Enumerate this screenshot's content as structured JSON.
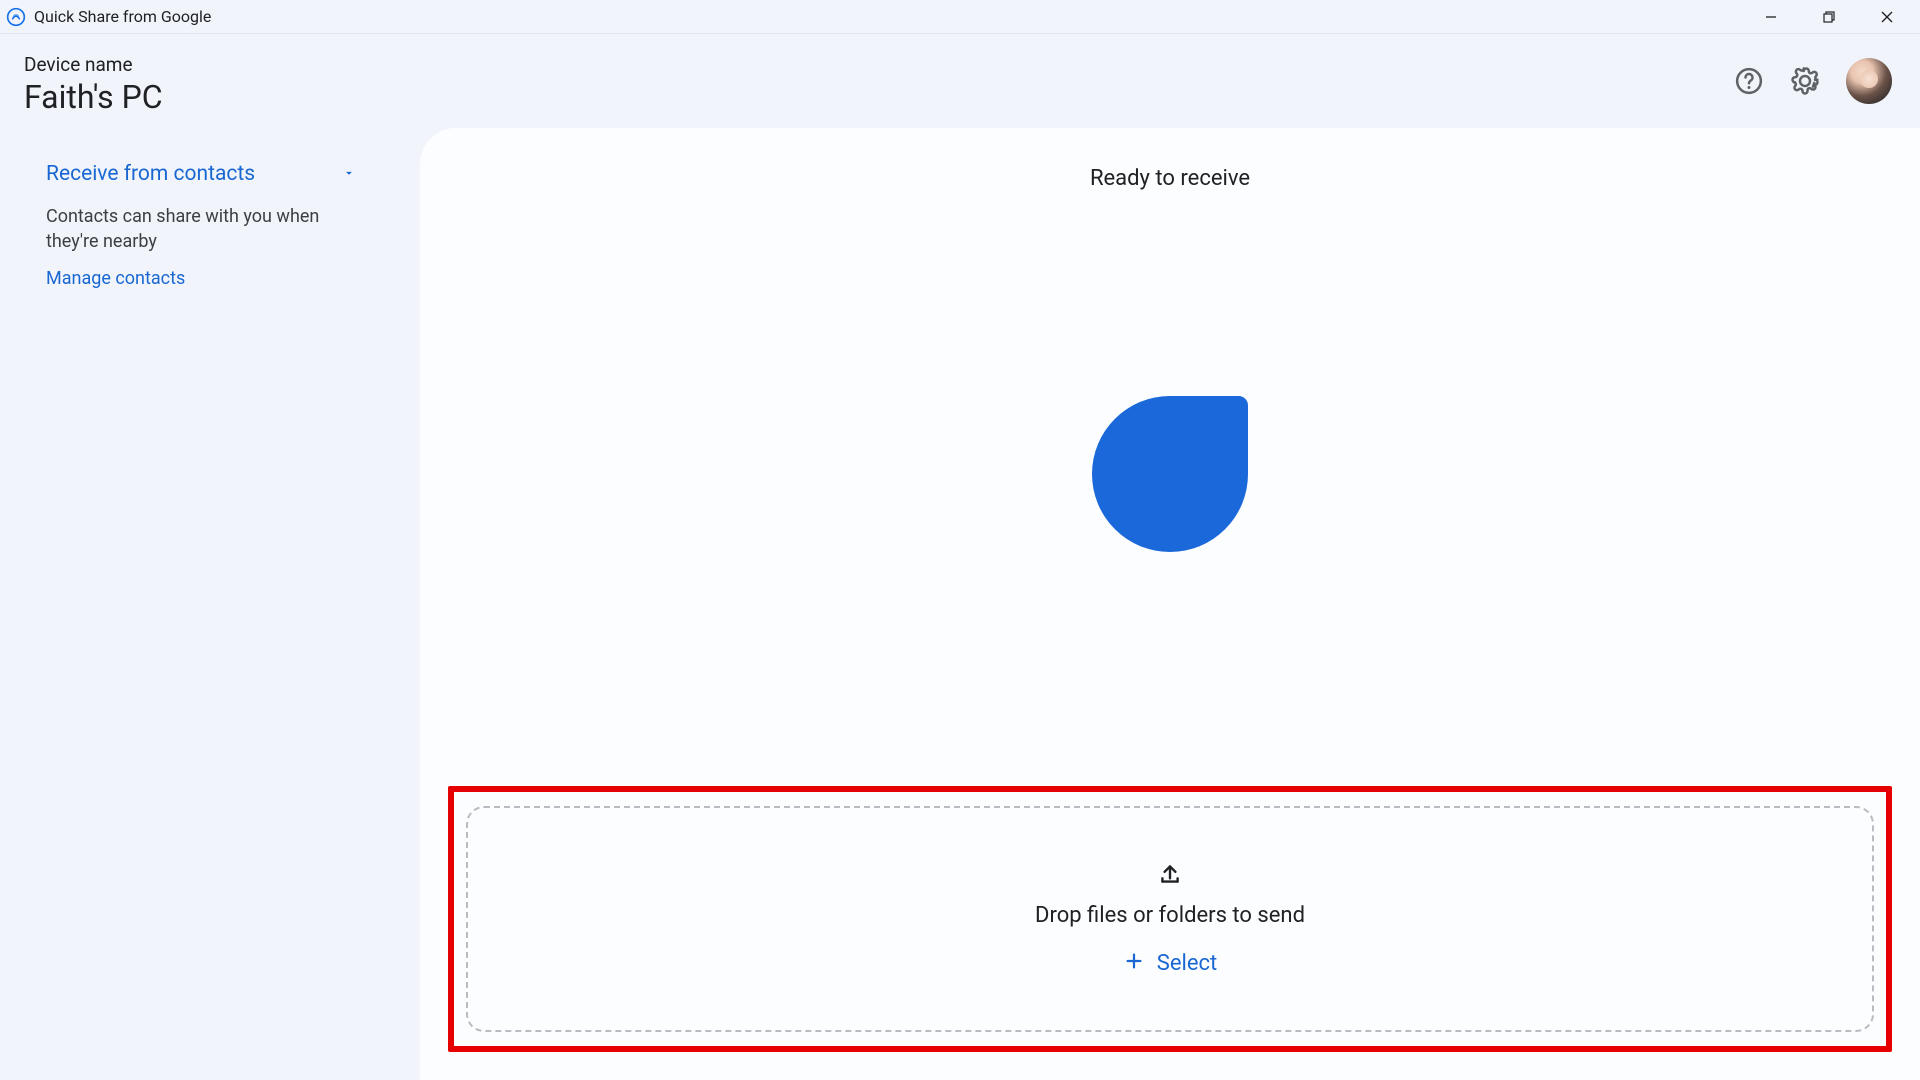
{
  "window": {
    "title": "Quick Share from Google"
  },
  "header": {
    "device_label": "Device name",
    "device_name": "Faith's PC"
  },
  "sidebar": {
    "receive_mode_label": "Receive from contacts",
    "receive_desc": "Contacts can share with you when they're nearby",
    "manage_label": "Manage contacts"
  },
  "main": {
    "ready_text": "Ready to receive",
    "drop_text": "Drop files or folders to send",
    "select_label": "Select"
  },
  "colors": {
    "accent": "#1967d2",
    "blob": "#1a68da",
    "highlight_border": "#e60000"
  }
}
